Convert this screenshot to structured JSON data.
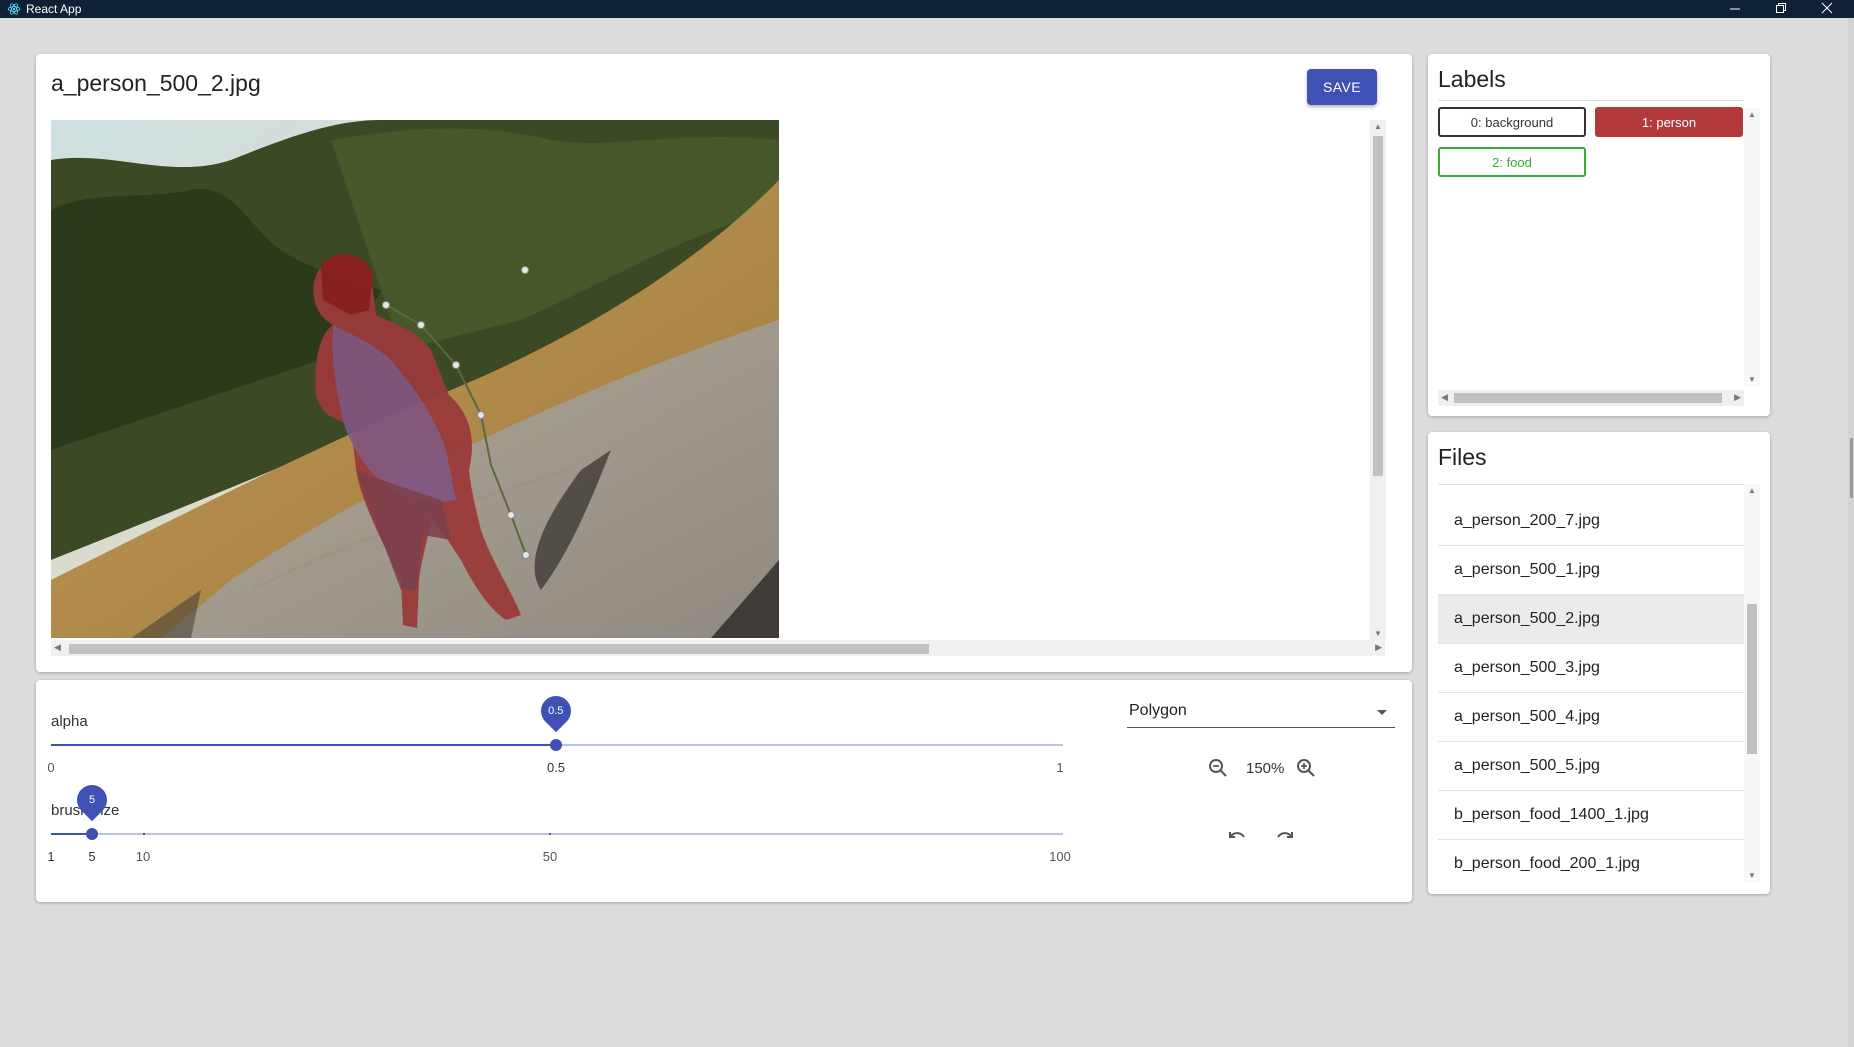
{
  "window": {
    "title": "React App",
    "icon": "react-icon",
    "controls": [
      "minimize-icon",
      "restore-icon",
      "close-icon"
    ]
  },
  "editor": {
    "filename": "a_person_500_2.jpg",
    "save_label": "SAVE",
    "image_subject": "person standing on a gravel road, partially outlined by a polygon annotation"
  },
  "controls": {
    "alpha": {
      "label": "alpha",
      "value": "0.5",
      "min_label": "0",
      "mid_label": "0.5",
      "max_label": "1"
    },
    "brush": {
      "label": "brush size",
      "value": "5",
      "marks": [
        "1",
        "5",
        "10",
        "50",
        "100"
      ]
    },
    "tool": {
      "selected": "Polygon"
    },
    "zoom": {
      "level": "150%"
    }
  },
  "labels": {
    "heading": "Labels",
    "items": [
      {
        "label": "0: background",
        "color": "#333333",
        "selected": false
      },
      {
        "label": "1: person",
        "color": "#b23a3a",
        "selected": true
      },
      {
        "label": "2: food",
        "color": "#3aa83a",
        "selected": false
      }
    ]
  },
  "files": {
    "heading": "Files",
    "items": [
      {
        "name": "a_person_200_7.jpg",
        "selected": false
      },
      {
        "name": "a_person_500_1.jpg",
        "selected": false
      },
      {
        "name": "a_person_500_2.jpg",
        "selected": true
      },
      {
        "name": "a_person_500_3.jpg",
        "selected": false
      },
      {
        "name": "a_person_500_4.jpg",
        "selected": false
      },
      {
        "name": "a_person_500_5.jpg",
        "selected": false
      },
      {
        "name": "b_person_food_1400_1.jpg",
        "selected": false
      },
      {
        "name": "b_person_food_200_1.jpg",
        "selected": false
      }
    ]
  },
  "colors": {
    "primary": "#3f51b5",
    "titlebar": "#0f2136",
    "background": "#dcdcdc"
  }
}
